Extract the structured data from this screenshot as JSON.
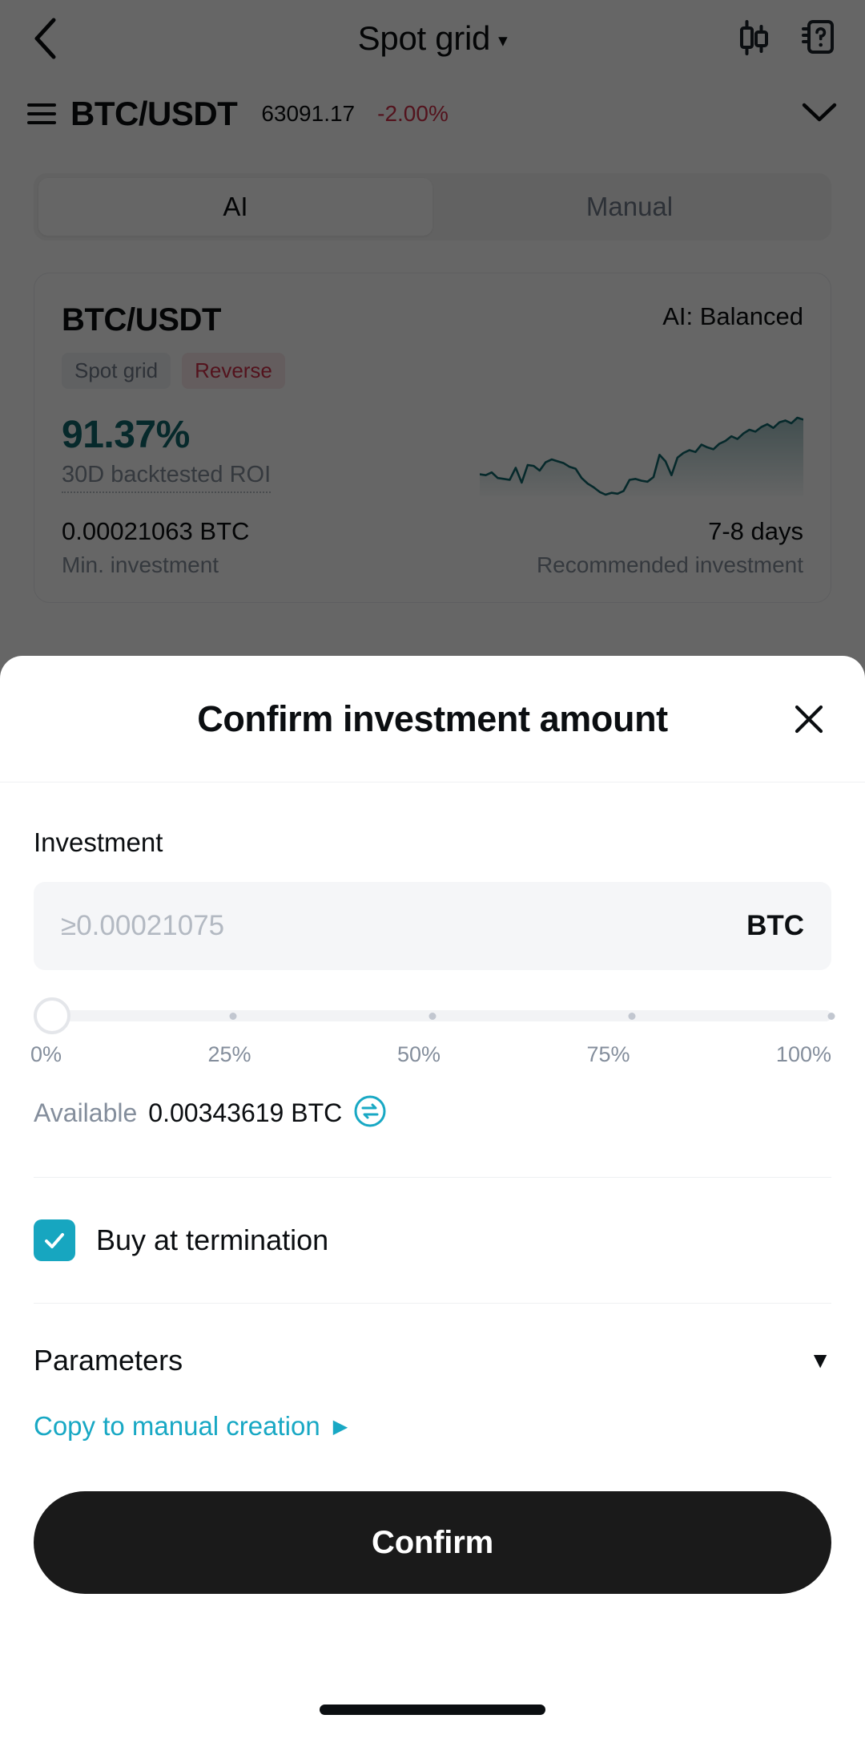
{
  "header": {
    "back_icon": "back-chevron-icon",
    "title": "Spot grid",
    "title_caret": "▾",
    "chart_icon": "candlestick-chart-icon",
    "help_icon": "help-book-icon"
  },
  "pair_bar": {
    "menu_icon": "hamburger-icon",
    "pair": "BTC/USDT",
    "price": "63091.17",
    "change": "-2.00%",
    "change_color": "#cf304a",
    "expand_icon": "chevron-down-icon"
  },
  "tabs": [
    {
      "label": "AI",
      "active": true
    },
    {
      "label": "Manual",
      "active": false
    }
  ],
  "strategy_card": {
    "pair": "BTC/USDT",
    "ai_mode": "AI: Balanced",
    "tags": [
      {
        "label": "Spot grid",
        "style": "gray"
      },
      {
        "label": "Reverse",
        "style": "red"
      }
    ],
    "roi_value": "91.37%",
    "roi_label": "30D backtested ROI",
    "roi_color": "#11666b",
    "min_investment_value": "0.00021063 BTC",
    "min_investment_label": "Min. investment",
    "duration_value": "7-8 days",
    "duration_label": "Recommended investment"
  },
  "chart_data": {
    "type": "area",
    "title": "30D backtested ROI sparkline",
    "xlabel": "",
    "ylabel": "",
    "series": [
      {
        "name": "Backtested ROI",
        "values": [
          34,
          33,
          36,
          30,
          29,
          28,
          41,
          25,
          44,
          43,
          38,
          47,
          50,
          48,
          46,
          42,
          40,
          30,
          24,
          20,
          15,
          12,
          14,
          13,
          16,
          28,
          29,
          27,
          26,
          31,
          55,
          48,
          33,
          52,
          57,
          60,
          58,
          66,
          63,
          61,
          67,
          70,
          75,
          72,
          78,
          82,
          80,
          85,
          88,
          84,
          90,
          92,
          89,
          95,
          93
        ]
      }
    ],
    "line_color": "#11666b",
    "fill_top": "rgba(17,102,107,0.38)",
    "fill_bottom": "rgba(17,102,107,0.02)",
    "grid": false,
    "legend": "none",
    "ylim": [
      0,
      100
    ]
  },
  "sheet": {
    "title": "Confirm investment amount",
    "close_icon": "close-icon",
    "investment_label": "Investment",
    "amount_value": "",
    "amount_placeholder": "≥0.00021075",
    "amount_unit": "BTC",
    "slider": {
      "value_percent": 0,
      "ticks": [
        "0%",
        "25%",
        "50%",
        "75%",
        "100%"
      ]
    },
    "available_label": "Available",
    "available_value": "0.00343619 BTC",
    "swap_icon": "swap-circle-icon",
    "checkbox": {
      "checked": true,
      "label": "Buy at termination",
      "accent": "#17a6c0"
    },
    "parameters_label": "Parameters",
    "parameters_caret": "▼",
    "copy_link": "Copy to manual creation",
    "copy_caret": "▶",
    "copy_color": "#18a8c4",
    "confirm_label": "Confirm",
    "confirm_bg": "#1a1a1a"
  }
}
